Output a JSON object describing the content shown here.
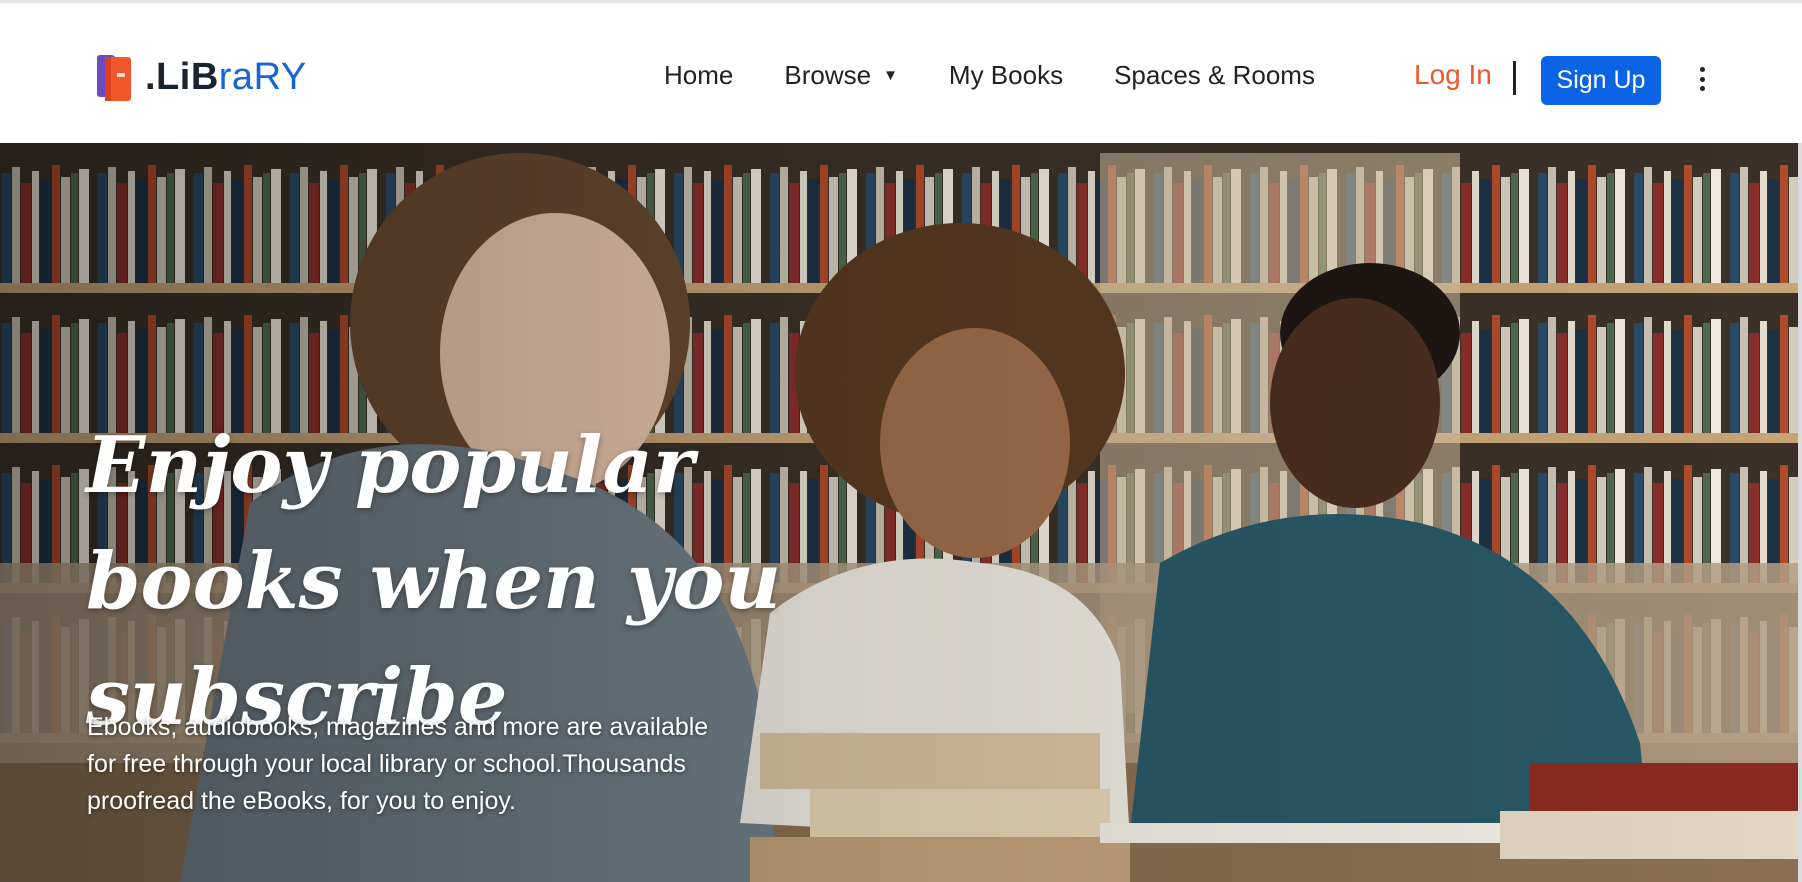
{
  "brand": {
    "logo_prefix": ".Li",
    "logo_mid": "B",
    "logo_suffix": "raRY",
    "icon": "books-icon",
    "colors": {
      "dark": "#1b2330",
      "blue": "#1565d8"
    }
  },
  "nav": {
    "items": [
      {
        "label": "Home"
      },
      {
        "label": "Browse",
        "has_dropdown": true
      },
      {
        "label": "My Books"
      },
      {
        "label": "Spaces & Rooms"
      }
    ],
    "login_label": "Log In",
    "signup_label": "Sign Up",
    "menu_icon": "kebab-menu-icon",
    "colors": {
      "login": "#f0582b",
      "signup_bg": "#0b63e5"
    }
  },
  "hero": {
    "title_line1": "Enjoy popular",
    "title_line2": "books when you subscribe",
    "description": "Ebooks, audiobooks, magazines and more are available for free through your local library or school.Thousands proofread the eBooks, for you to enjoy.",
    "background": "library-photo"
  }
}
